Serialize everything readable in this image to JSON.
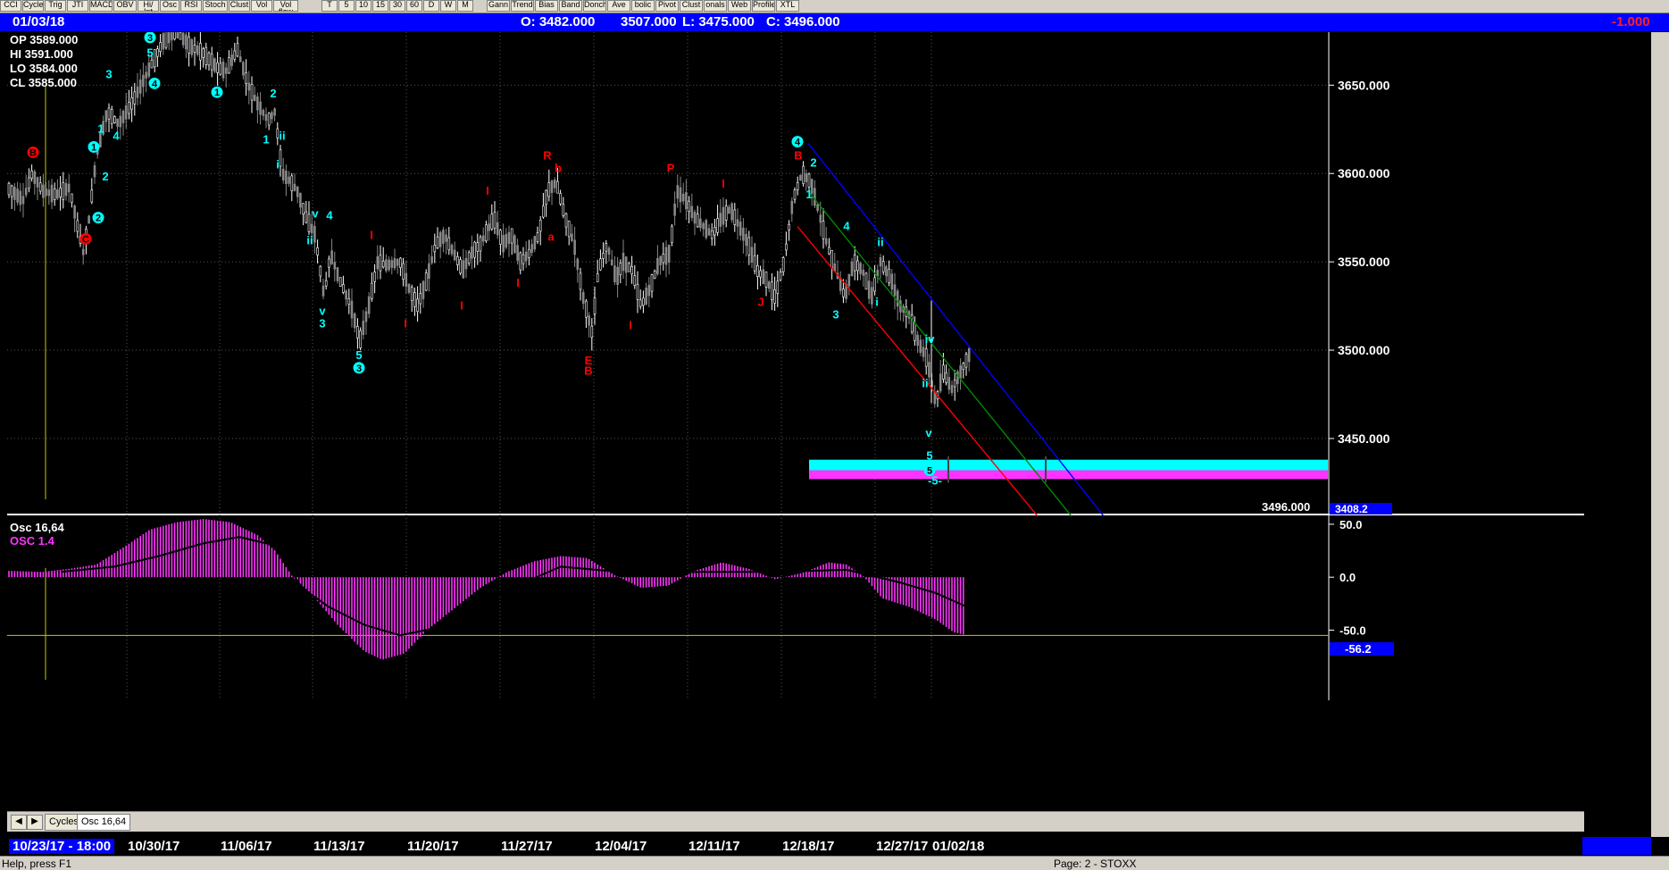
{
  "toolbar": {
    "left_buttons": [
      "CCI",
      "Cycles",
      "Trig",
      "JTI",
      "MACD",
      "OBV",
      "Hi/ Int",
      "Osc",
      "RSI",
      "Stoch",
      "Clust",
      "Vol",
      "Vol flow"
    ],
    "timeframes": [
      "T",
      "5",
      "10",
      "15",
      "30",
      "60",
      "D",
      "W",
      "M"
    ],
    "right_buttons": [
      "Gann",
      "Trend",
      "Bias",
      "Band",
      "Donch",
      "Ave",
      "bolic",
      "Pivot",
      "Clust",
      "onals",
      "Web",
      "Profile",
      "XTL"
    ]
  },
  "info": {
    "date": "01/03/18",
    "open": "O: 3482.000",
    "high": "3507.000",
    "low": "L: 3475.000",
    "close": "C: 3496.000",
    "change": "-1.000"
  },
  "ohlc_box": {
    "op": "OP  3589.000",
    "hi": "HI   3591.000",
    "lo": "LO  3584.000",
    "cl": "CL   3585.000"
  },
  "price_box_last": "3496.000",
  "price_box_low": "3408.2",
  "osc": {
    "label1": "Osc 16,64",
    "label2": "OSC 1.4",
    "value_box": "-56.2"
  },
  "tabs": [
    "Cycles",
    "Osc 16,64"
  ],
  "status": {
    "help": "Help, press F1",
    "page": "Page: 2 - STOXX"
  },
  "colors": {
    "up_bar": "#ffffff",
    "down_bar": "#888888",
    "osc": "#ff33ff",
    "signal": "#000000",
    "wave_cyan": "#00ffff",
    "wave_red": "#ff0000",
    "band_cyan": "#00ffff",
    "band_magenta": "#ff33ff",
    "channel_blue": "#0000ff",
    "channel_green": "#008800",
    "channel_red": "#ff0000",
    "axis_bg": "#000000"
  },
  "chart_data": [
    {
      "type": "candlestick",
      "x_labels": [
        "10/23/17 - 18:00",
        "10/30/17",
        "11/06/17",
        "11/13/17",
        "11/20/17",
        "11/27/17",
        "12/04/17",
        "12/11/17",
        "12/18/17",
        "12/27/17",
        "01/02/18"
      ],
      "yticks": [
        3450,
        3500,
        3550,
        3600,
        3650
      ],
      "ytick_labels": [
        "3450.000",
        "3500.000",
        "3550.000",
        "3600.000",
        "3650.000"
      ],
      "ylim": [
        3408,
        3680
      ],
      "price_path": [
        [
          0,
          3592
        ],
        [
          18,
          3585
        ],
        [
          28,
          3600
        ],
        [
          40,
          3590
        ],
        [
          55,
          3588
        ],
        [
          70,
          3592
        ],
        [
          85,
          3555
        ],
        [
          92,
          3575
        ],
        [
          100,
          3610
        ],
        [
          112,
          3635
        ],
        [
          125,
          3628
        ],
        [
          140,
          3640
        ],
        [
          155,
          3655
        ],
        [
          165,
          3665
        ],
        [
          175,
          3675
        ],
        [
          190,
          3680
        ],
        [
          205,
          3672
        ],
        [
          220,
          3668
        ],
        [
          235,
          3660
        ],
        [
          245,
          3658
        ],
        [
          258,
          3670
        ],
        [
          270,
          3650
        ],
        [
          280,
          3640
        ],
        [
          292,
          3630
        ],
        [
          300,
          3635
        ],
        [
          308,
          3600
        ],
        [
          318,
          3595
        ],
        [
          325,
          3590
        ],
        [
          335,
          3575
        ],
        [
          345,
          3565
        ],
        [
          355,
          3530
        ],
        [
          362,
          3555
        ],
        [
          372,
          3540
        ],
        [
          385,
          3525
        ],
        [
          395,
          3505
        ],
        [
          405,
          3525
        ],
        [
          415,
          3550
        ],
        [
          425,
          3548
        ],
        [
          440,
          3550
        ],
        [
          450,
          3535
        ],
        [
          460,
          3525
        ],
        [
          470,
          3540
        ],
        [
          480,
          3560
        ],
        [
          490,
          3565
        ],
        [
          500,
          3555
        ],
        [
          510,
          3545
        ],
        [
          520,
          3555
        ],
        [
          530,
          3560
        ],
        [
          545,
          3575
        ],
        [
          555,
          3560
        ],
        [
          565,
          3565
        ],
        [
          575,
          3550
        ],
        [
          585,
          3555
        ],
        [
          595,
          3565
        ],
        [
          605,
          3590
        ],
        [
          615,
          3595
        ],
        [
          625,
          3575
        ],
        [
          635,
          3560
        ],
        [
          645,
          3530
        ],
        [
          655,
          3510
        ],
        [
          662,
          3545
        ],
        [
          672,
          3560
        ],
        [
          682,
          3540
        ],
        [
          690,
          3550
        ],
        [
          700,
          3545
        ],
        [
          710,
          3525
        ],
        [
          720,
          3535
        ],
        [
          730,
          3550
        ],
        [
          742,
          3555
        ],
        [
          750,
          3590
        ],
        [
          760,
          3585
        ],
        [
          770,
          3575
        ],
        [
          780,
          3570
        ],
        [
          790,
          3565
        ],
        [
          800,
          3575
        ],
        [
          810,
          3580
        ],
        [
          820,
          3570
        ],
        [
          830,
          3560
        ],
        [
          840,
          3545
        ],
        [
          850,
          3540
        ],
        [
          860,
          3530
        ],
        [
          870,
          3550
        ],
        [
          880,
          3585
        ],
        [
          890,
          3600
        ],
        [
          900,
          3595
        ],
        [
          908,
          3580
        ],
        [
          918,
          3560
        ],
        [
          928,
          3545
        ],
        [
          938,
          3530
        ],
        [
          948,
          3550
        ],
        [
          958,
          3545
        ],
        [
          968,
          3530
        ],
        [
          978,
          3550
        ],
        [
          990,
          3540
        ],
        [
          1000,
          3525
        ],
        [
          1010,
          3520
        ],
        [
          1020,
          3505
        ],
        [
          1030,
          3495
        ],
        [
          1040,
          3470
        ],
        [
          1048,
          3488
        ],
        [
          1058,
          3478
        ],
        [
          1068,
          3488
        ],
        [
          1078,
          3498
        ]
      ],
      "channels": [
        {
          "color": "blue",
          "from": [
            905,
            3617
          ],
          "to": [
            1236,
            3406
          ]
        },
        {
          "color": "green",
          "from": [
            905,
            3590
          ],
          "to": [
            1200,
            3406
          ]
        },
        {
          "color": "red",
          "from": [
            893,
            3570
          ],
          "to": [
            1162,
            3406
          ]
        }
      ],
      "bands": [
        {
          "color": "cyan",
          "from_x": 906,
          "to_x": 1487,
          "y_top": 3438,
          "y_bottom": 3432
        },
        {
          "color": "magenta",
          "from_x": 906,
          "to_x": 1487,
          "y_top": 3432,
          "y_bottom": 3427
        }
      ],
      "wave_labels": [
        {
          "x": 37,
          "y": 3610,
          "text": "B",
          "color": "red",
          "circled": true
        },
        {
          "x": 96,
          "y": 3561,
          "text": "C",
          "color": "red",
          "circled": true
        },
        {
          "x": 110,
          "y": 3573,
          "text": "2",
          "color": "cyan",
          "circled": true
        },
        {
          "x": 105,
          "y": 3613,
          "text": "1",
          "color": "cyan",
          "circled": true
        },
        {
          "x": 118,
          "y": 3596,
          "text": "2",
          "color": "cyan"
        },
        {
          "x": 113,
          "y": 3623,
          "text": "1",
          "color": "cyan"
        },
        {
          "x": 130,
          "y": 3619,
          "text": "4",
          "color": "cyan"
        },
        {
          "x": 122,
          "y": 3654,
          "text": "3",
          "color": "cyan"
        },
        {
          "x": 168,
          "y": 3666,
          "text": "5",
          "color": "cyan"
        },
        {
          "x": 168,
          "y": 3675,
          "text": "3",
          "color": "cyan",
          "circled": true
        },
        {
          "x": 173,
          "y": 3649,
          "text": "4",
          "color": "cyan",
          "circled": true
        },
        {
          "x": 243,
          "y": 3644,
          "text": "1",
          "color": "cyan",
          "circled": true
        },
        {
          "x": 306,
          "y": 3643,
          "text": "2",
          "color": "cyan"
        },
        {
          "x": 298,
          "y": 3617,
          "text": "1",
          "color": "cyan"
        },
        {
          "x": 316,
          "y": 3619,
          "text": "ii",
          "color": "cyan"
        },
        {
          "x": 311,
          "y": 3603,
          "text": "i",
          "color": "cyan"
        },
        {
          "x": 353,
          "y": 3575,
          "text": "v",
          "color": "cyan"
        },
        {
          "x": 369,
          "y": 3574,
          "text": "4",
          "color": "cyan"
        },
        {
          "x": 347,
          "y": 3560,
          "text": "ii",
          "color": "cyan"
        },
        {
          "x": 361,
          "y": 3520,
          "text": "v",
          "color": "cyan"
        },
        {
          "x": 361,
          "y": 3513,
          "text": "3",
          "color": "cyan"
        },
        {
          "x": 402,
          "y": 3495,
          "text": "5",
          "color": "cyan"
        },
        {
          "x": 402,
          "y": 3488,
          "text": "3",
          "color": "cyan",
          "circled": true
        },
        {
          "x": 416,
          "y": 3563,
          "text": "I",
          "color": "red"
        },
        {
          "x": 454,
          "y": 3513,
          "text": "I",
          "color": "red"
        },
        {
          "x": 517,
          "y": 3523,
          "text": "I",
          "color": "red"
        },
        {
          "x": 546,
          "y": 3588,
          "text": "I",
          "color": "red"
        },
        {
          "x": 580,
          "y": 3536,
          "text": "I",
          "color": "red"
        },
        {
          "x": 613,
          "y": 3608,
          "text": "R",
          "color": "red"
        },
        {
          "x": 625,
          "y": 3601,
          "text": "b",
          "color": "red"
        },
        {
          "x": 617,
          "y": 3562,
          "text": "a",
          "color": "red"
        },
        {
          "x": 659,
          "y": 3492,
          "text": "E",
          "color": "red"
        },
        {
          "x": 659,
          "y": 3486,
          "text": "B",
          "color": "red"
        },
        {
          "x": 706,
          "y": 3512,
          "text": "I",
          "color": "red"
        },
        {
          "x": 751,
          "y": 3601,
          "text": "P",
          "color": "red"
        },
        {
          "x": 810,
          "y": 3592,
          "text": "I",
          "color": "red"
        },
        {
          "x": 852,
          "y": 3525,
          "text": "J",
          "color": "red"
        },
        {
          "x": 893,
          "y": 3616,
          "text": "4",
          "color": "cyan",
          "circled": true
        },
        {
          "x": 894,
          "y": 3608,
          "text": "B",
          "color": "red"
        },
        {
          "x": 911,
          "y": 3604,
          "text": "2",
          "color": "cyan"
        },
        {
          "x": 906,
          "y": 3586,
          "text": "1",
          "color": "cyan"
        },
        {
          "x": 948,
          "y": 3568,
          "text": "4",
          "color": "cyan"
        },
        {
          "x": 936,
          "y": 3518,
          "text": "3",
          "color": "cyan"
        },
        {
          "x": 986,
          "y": 3559,
          "text": "ii",
          "color": "cyan"
        },
        {
          "x": 982,
          "y": 3525,
          "text": "i",
          "color": "cyan"
        },
        {
          "x": 1041,
          "y": 3504,
          "text": "iv",
          "color": "cyan"
        },
        {
          "x": 1036,
          "y": 3479,
          "text": "ii",
          "color": "cyan"
        },
        {
          "x": 1040,
          "y": 3451,
          "text": "v",
          "color": "cyan"
        },
        {
          "x": 1041,
          "y": 3438,
          "text": "5",
          "color": "cyan"
        },
        {
          "x": 1041,
          "y": 3430,
          "text": "5",
          "color": "cyan",
          "circled": true
        },
        {
          "x": 1047,
          "y": 3424,
          "text": "-5-",
          "color": "cyan"
        }
      ]
    },
    {
      "type": "bar",
      "name": "Osc 16,64",
      "yticks": [
        50.0,
        0.0,
        -50.0
      ],
      "ytick_labels": [
        "50.0",
        "0.0",
        "-50.0"
      ],
      "ylim": [
        -80,
        55
      ],
      "osc_path": [
        [
          0,
          6
        ],
        [
          40,
          5
        ],
        [
          70,
          8
        ],
        [
          100,
          12
        ],
        [
          130,
          28
        ],
        [
          160,
          45
        ],
        [
          190,
          52
        ],
        [
          220,
          55
        ],
        [
          250,
          52
        ],
        [
          280,
          40
        ],
        [
          300,
          25
        ],
        [
          320,
          0
        ],
        [
          340,
          -15
        ],
        [
          370,
          -45
        ],
        [
          400,
          -70
        ],
        [
          420,
          -78
        ],
        [
          445,
          -72
        ],
        [
          470,
          -50
        ],
        [
          500,
          -30
        ],
        [
          530,
          -10
        ],
        [
          560,
          5
        ],
        [
          590,
          15
        ],
        [
          620,
          20
        ],
        [
          650,
          18
        ],
        [
          680,
          2
        ],
        [
          710,
          -10
        ],
        [
          740,
          -8
        ],
        [
          770,
          6
        ],
        [
          800,
          14
        ],
        [
          830,
          8
        ],
        [
          860,
          -2
        ],
        [
          890,
          4
        ],
        [
          920,
          14
        ],
        [
          940,
          12
        ],
        [
          960,
          0
        ],
        [
          980,
          -20
        ],
        [
          1010,
          -28
        ],
        [
          1040,
          -40
        ],
        [
          1060,
          -52
        ],
        [
          1080,
          -56
        ]
      ],
      "signal_path": [
        [
          60,
          5
        ],
        [
          120,
          10
        ],
        [
          170,
          20
        ],
        [
          220,
          32
        ],
        [
          260,
          38
        ],
        [
          300,
          30
        ],
        [
          330,
          -10
        ],
        [
          360,
          -28
        ],
        [
          400,
          -45
        ],
        [
          440,
          -55
        ],
        [
          480,
          -48
        ],
        [
          520,
          -30
        ],
        [
          560,
          -12
        ],
        [
          620,
          10
        ],
        [
          700,
          4
        ],
        [
          780,
          5
        ],
        [
          860,
          5
        ],
        [
          940,
          7
        ],
        [
          1000,
          -5
        ],
        [
          1040,
          -15
        ],
        [
          1080,
          -30
        ]
      ]
    }
  ]
}
